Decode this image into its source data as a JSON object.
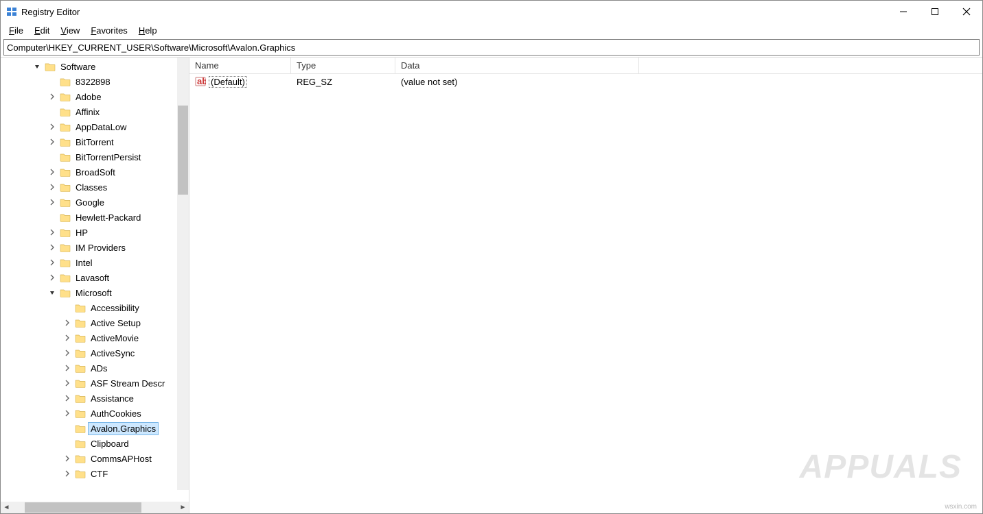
{
  "window": {
    "title": "Registry Editor"
  },
  "menus": {
    "file": "File",
    "edit": "Edit",
    "view": "View",
    "favorites": "Favorites",
    "help": "Help"
  },
  "address": "Computer\\HKEY_CURRENT_USER\\Software\\Microsoft\\Avalon.Graphics",
  "tree": {
    "root": "Software",
    "items": [
      {
        "label": "8322898",
        "exp": "",
        "depth": 1
      },
      {
        "label": "Adobe",
        "exp": ">",
        "depth": 1
      },
      {
        "label": "Affinix",
        "exp": "",
        "depth": 1
      },
      {
        "label": "AppDataLow",
        "exp": ">",
        "depth": 1
      },
      {
        "label": "BitTorrent",
        "exp": ">",
        "depth": 1
      },
      {
        "label": "BitTorrentPersist",
        "exp": "",
        "depth": 1
      },
      {
        "label": "BroadSoft",
        "exp": ">",
        "depth": 1
      },
      {
        "label": "Classes",
        "exp": ">",
        "depth": 1
      },
      {
        "label": "Google",
        "exp": ">",
        "depth": 1
      },
      {
        "label": "Hewlett-Packard",
        "exp": "",
        "depth": 1
      },
      {
        "label": "HP",
        "exp": ">",
        "depth": 1
      },
      {
        "label": "IM Providers",
        "exp": ">",
        "depth": 1
      },
      {
        "label": "Intel",
        "exp": ">",
        "depth": 1
      },
      {
        "label": "Lavasoft",
        "exp": ">",
        "depth": 1
      },
      {
        "label": "Microsoft",
        "exp": "v",
        "depth": 1
      },
      {
        "label": "Accessibility",
        "exp": "",
        "depth": 2
      },
      {
        "label": "Active Setup",
        "exp": ">",
        "depth": 2
      },
      {
        "label": "ActiveMovie",
        "exp": ">",
        "depth": 2
      },
      {
        "label": "ActiveSync",
        "exp": ">",
        "depth": 2
      },
      {
        "label": "ADs",
        "exp": ">",
        "depth": 2
      },
      {
        "label": "ASF Stream Descr",
        "exp": ">",
        "depth": 2
      },
      {
        "label": "Assistance",
        "exp": ">",
        "depth": 2
      },
      {
        "label": "AuthCookies",
        "exp": ">",
        "depth": 2
      },
      {
        "label": "Avalon.Graphics",
        "exp": "",
        "depth": 2,
        "selected": true
      },
      {
        "label": "Clipboard",
        "exp": "",
        "depth": 2
      },
      {
        "label": "CommsAPHost",
        "exp": ">",
        "depth": 2
      },
      {
        "label": "CTF",
        "exp": ">",
        "depth": 2
      }
    ]
  },
  "list": {
    "headers": {
      "name": "Name",
      "type": "Type",
      "data": "Data"
    },
    "rows": [
      {
        "name": "(Default)",
        "type": "REG_SZ",
        "data": "(value not set)"
      }
    ]
  },
  "watermark": "APPUALS",
  "attribution": "wsxin.com"
}
